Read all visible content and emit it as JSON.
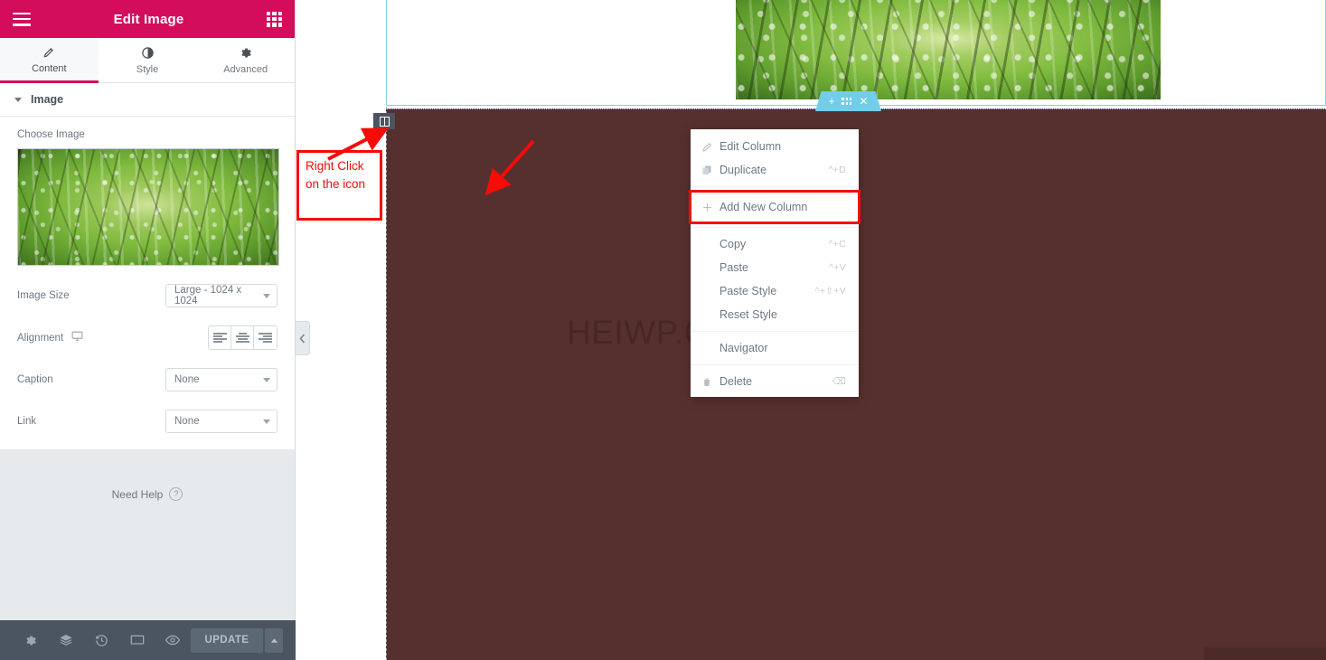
{
  "panel": {
    "title": "Edit Image",
    "menu_icon": "hamburger-icon",
    "apps_icon": "grid-apps-icon",
    "tabs": [
      {
        "label": "Content",
        "icon": "pencil-icon",
        "active": true
      },
      {
        "label": "Style",
        "icon": "contrast-circle-icon",
        "active": false
      },
      {
        "label": "Advanced",
        "icon": "gear-icon",
        "active": false
      }
    ],
    "section": {
      "label": "Image",
      "expanded": true
    },
    "fields": {
      "choose_image_label": "Choose Image",
      "image_size_label": "Image Size",
      "image_size_value": "Large - 1024 x 1024",
      "alignment_label": "Alignment",
      "alignment_device_icon": "desktop-icon",
      "alignment_options": [
        "align-left",
        "align-center",
        "align-right"
      ],
      "caption_label": "Caption",
      "caption_value": "None",
      "link_label": "Link",
      "link_value": "None"
    },
    "need_help": {
      "label": "Need Help",
      "icon": "question-circle-icon"
    },
    "footer": {
      "buttons": [
        {
          "name": "settings-button",
          "icon": "gear-icon"
        },
        {
          "name": "navigator-button",
          "icon": "layers-icon"
        },
        {
          "name": "history-button",
          "icon": "history-icon"
        },
        {
          "name": "responsive-mode-button",
          "icon": "monitor-icon"
        },
        {
          "name": "preview-button",
          "icon": "eye-icon"
        }
      ],
      "update_label": "UPDATE",
      "update_caret_icon": "chevron-up-icon"
    },
    "collapse_icon": "chevron-left-icon"
  },
  "canvas": {
    "hero_image_alt": "forest-canopy-image",
    "section_toolbar": [
      {
        "name": "add-section-icon",
        "glyph": "+"
      },
      {
        "name": "edit-section-handle-icon",
        "glyph": "grid-dots"
      },
      {
        "name": "delete-section-icon",
        "glyph": "✕"
      }
    ],
    "watermark": "HEIWP.COM",
    "column_handle_icon": "column-handle-icon"
  },
  "context_menu": {
    "items": [
      {
        "label": "Edit Column",
        "shortcut": "",
        "icon": "pencil-icon",
        "highlighted": false,
        "separator_after": false
      },
      {
        "label": "Duplicate",
        "shortcut": "^+D",
        "icon": "copy-icon",
        "highlighted": false,
        "separator_after": true
      },
      {
        "label": "Add New Column",
        "shortcut": "",
        "icon": "plus-icon",
        "highlighted": true,
        "separator_after": true
      },
      {
        "label": "Copy",
        "shortcut": "^+C",
        "icon": "",
        "highlighted": false,
        "separator_after": false
      },
      {
        "label": "Paste",
        "shortcut": "^+V",
        "icon": "",
        "highlighted": false,
        "separator_after": false
      },
      {
        "label": "Paste Style",
        "shortcut": "^+⇧+V",
        "icon": "",
        "highlighted": false,
        "separator_after": false
      },
      {
        "label": "Reset Style",
        "shortcut": "",
        "icon": "",
        "highlighted": false,
        "separator_after": true
      },
      {
        "label": "Navigator",
        "shortcut": "",
        "icon": "",
        "highlighted": false,
        "separator_after": true
      },
      {
        "label": "Delete",
        "shortcut": "⌫",
        "icon": "trash-icon",
        "highlighted": false,
        "separator_after": false
      }
    ]
  },
  "annotations": {
    "note_text": "Right Click on the icon",
    "accent_color": "#f60b08",
    "brand_color": "#d30c5c",
    "section_bg_color": "#55302e",
    "toolbar_color": "#71cdea"
  }
}
